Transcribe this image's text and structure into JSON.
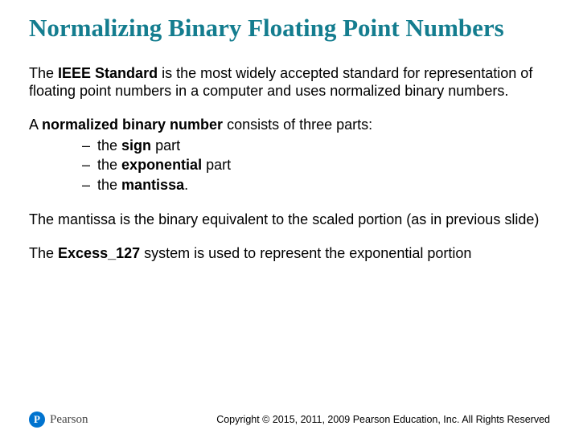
{
  "title": "Normalizing Binary Floating Point Numbers",
  "p1": {
    "pre": "The ",
    "b": "IEEE Standard",
    "post": " is the most widely accepted standard for representation of floating point numbers in a computer and uses normalized binary numbers."
  },
  "p2": {
    "pre": "A ",
    "b": "normalized binary number",
    "post": " consists of three parts:"
  },
  "bullets": [
    {
      "pre": "the ",
      "b": "sign",
      "post": " part"
    },
    {
      "pre": "the ",
      "b": "exponential",
      "post": " part"
    },
    {
      "pre": "the ",
      "b": "mantissa",
      "post": "."
    }
  ],
  "p3": "The mantissa is the binary equivalent to the scaled portion (as in previous slide)",
  "p4": {
    "pre": "The ",
    "b": "Excess_127",
    "post": " system is used to represent the exponential portion"
  },
  "brand": {
    "initial": "P",
    "name": "Pearson"
  },
  "copyright": "Copyright © 2015, 2011, 2009 Pearson Education, Inc. All Rights Reserved"
}
